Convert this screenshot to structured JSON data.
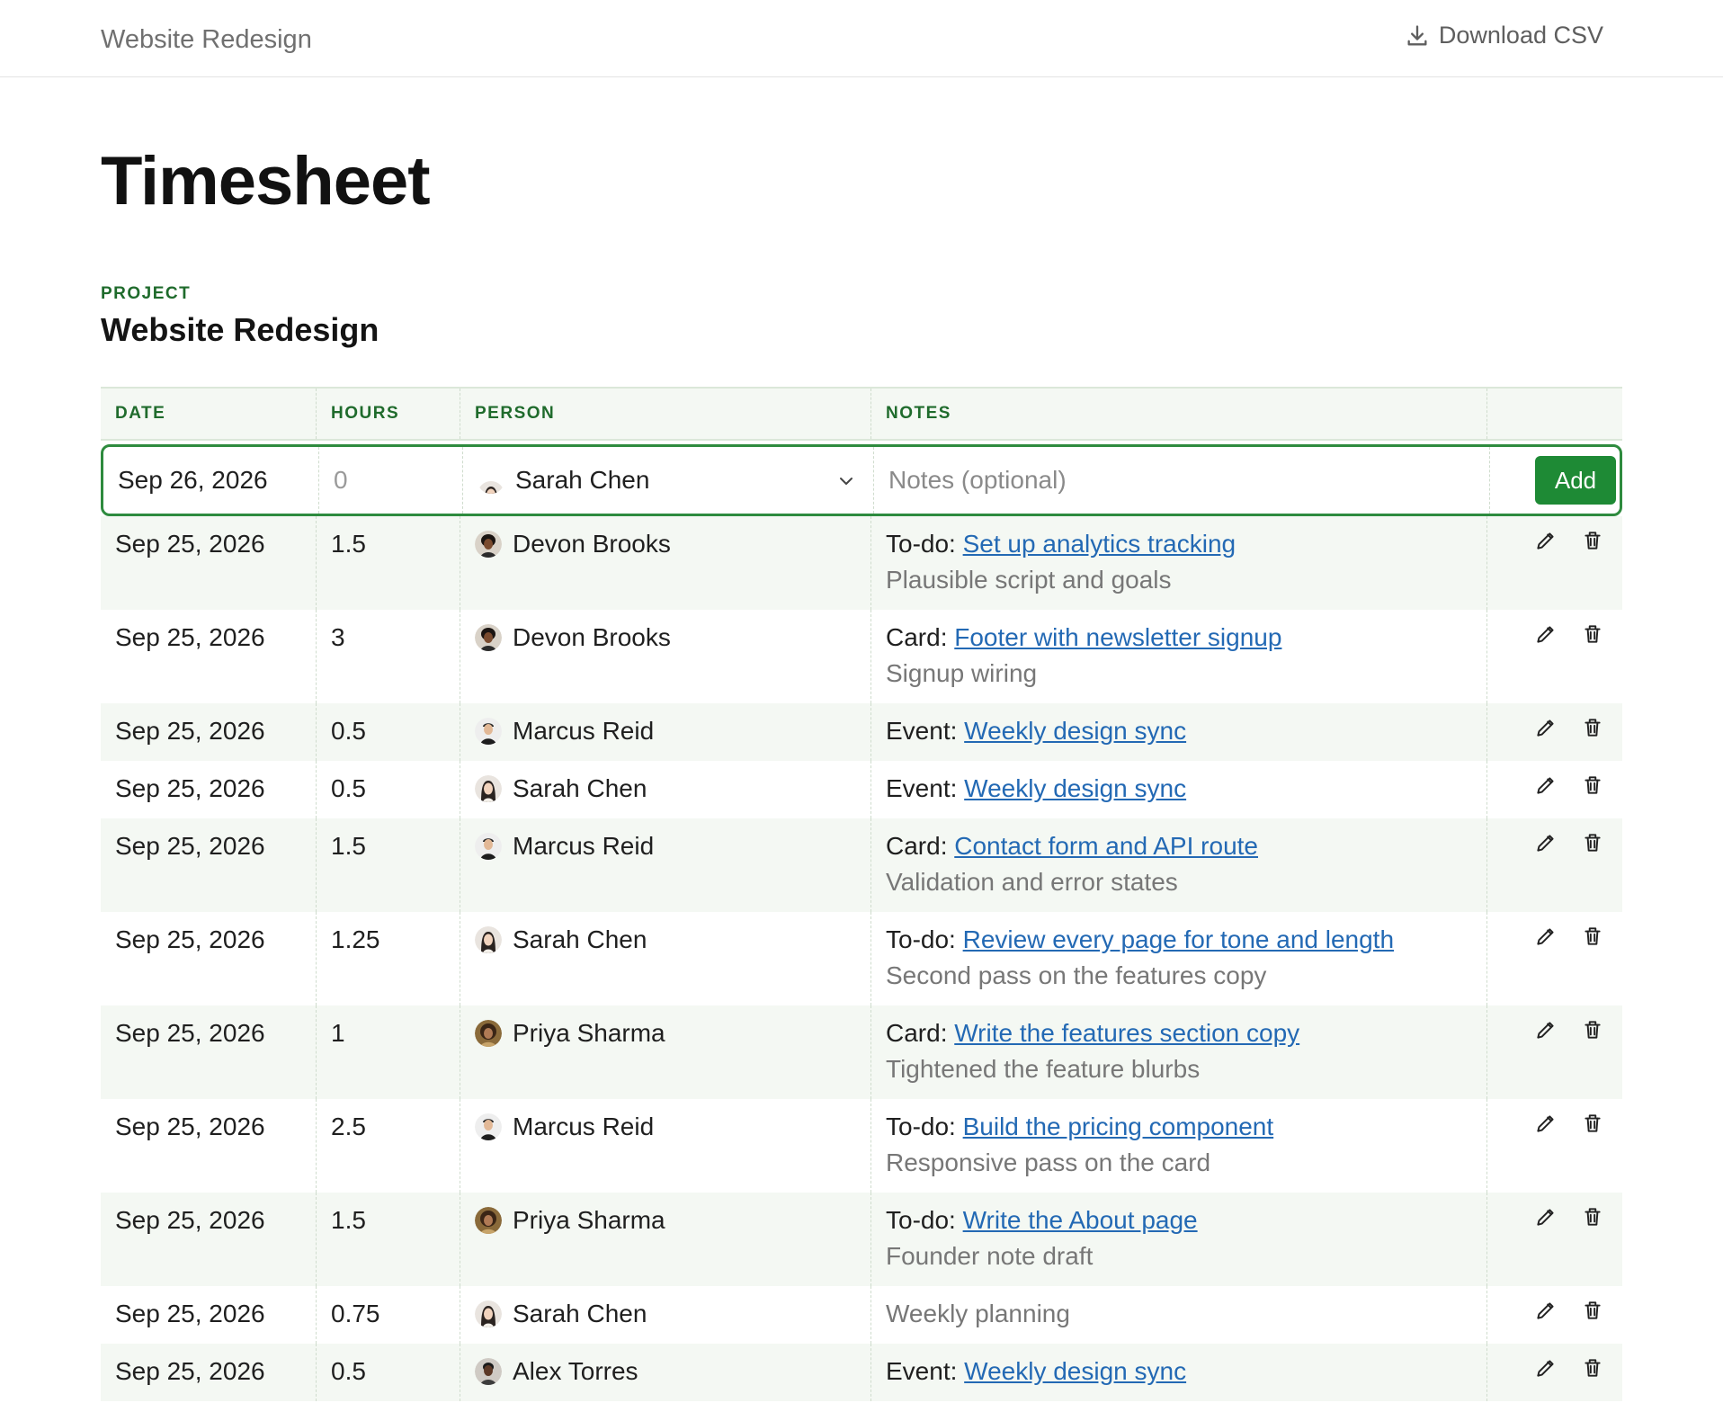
{
  "header": {
    "breadcrumb": "Website Redesign",
    "download_label": "Download CSV"
  },
  "page": {
    "title": "Timesheet",
    "project_label": "PROJECT",
    "project_name": "Website Redesign"
  },
  "table": {
    "columns": [
      "DATE",
      "HOURS",
      "PERSON",
      "NOTES"
    ],
    "entry": {
      "date": "Sep 26, 2026",
      "hours_placeholder": "0",
      "person": "Sarah Chen",
      "notes_placeholder": "Notes (optional)",
      "add_label": "Add"
    },
    "rows": [
      {
        "date": "Sep 25, 2026",
        "hours": "1.5",
        "person": "Devon Brooks",
        "avatar": "devon",
        "prefix": "To-do: ",
        "link": "Set up analytics tracking",
        "sub": "Plausible script and goals",
        "plain": ""
      },
      {
        "date": "Sep 25, 2026",
        "hours": "3",
        "person": "Devon Brooks",
        "avatar": "devon",
        "prefix": "Card: ",
        "link": "Footer with newsletter signup",
        "sub": "Signup wiring",
        "plain": ""
      },
      {
        "date": "Sep 25, 2026",
        "hours": "0.5",
        "person": "Marcus Reid",
        "avatar": "marcus",
        "prefix": "Event: ",
        "link": "Weekly design sync",
        "sub": "",
        "plain": ""
      },
      {
        "date": "Sep 25, 2026",
        "hours": "0.5",
        "person": "Sarah Chen",
        "avatar": "sarah",
        "prefix": "Event: ",
        "link": "Weekly design sync",
        "sub": "",
        "plain": ""
      },
      {
        "date": "Sep 25, 2026",
        "hours": "1.5",
        "person": "Marcus Reid",
        "avatar": "marcus",
        "prefix": "Card: ",
        "link": "Contact form and API route",
        "sub": "Validation and error states",
        "plain": ""
      },
      {
        "date": "Sep 25, 2026",
        "hours": "1.25",
        "person": "Sarah Chen",
        "avatar": "sarah",
        "prefix": "To-do: ",
        "link": "Review every page for tone and length",
        "sub": "Second pass on the features copy",
        "plain": ""
      },
      {
        "date": "Sep 25, 2026",
        "hours": "1",
        "person": "Priya Sharma",
        "avatar": "priya",
        "prefix": "Card: ",
        "link": "Write the features section copy",
        "sub": "Tightened the feature blurbs",
        "plain": ""
      },
      {
        "date": "Sep 25, 2026",
        "hours": "2.5",
        "person": "Marcus Reid",
        "avatar": "marcus",
        "prefix": "To-do: ",
        "link": "Build the pricing component",
        "sub": "Responsive pass on the card",
        "plain": ""
      },
      {
        "date": "Sep 25, 2026",
        "hours": "1.5",
        "person": "Priya Sharma",
        "avatar": "priya",
        "prefix": "To-do: ",
        "link": "Write the About page",
        "sub": "Founder note draft",
        "plain": ""
      },
      {
        "date": "Sep 25, 2026",
        "hours": "0.75",
        "person": "Sarah Chen",
        "avatar": "sarah",
        "prefix": "",
        "link": "",
        "sub": "",
        "plain": "Weekly planning"
      },
      {
        "date": "Sep 25, 2026",
        "hours": "0.5",
        "person": "Alex Torres",
        "avatar": "alex",
        "prefix": "Event: ",
        "link": "Weekly design sync",
        "sub": "",
        "plain": ""
      }
    ]
  },
  "colors": {
    "accent": "#1e8a35",
    "label_green": "#1f6b2c",
    "link": "#2369b4",
    "row_alt": "#f4f8f3"
  }
}
